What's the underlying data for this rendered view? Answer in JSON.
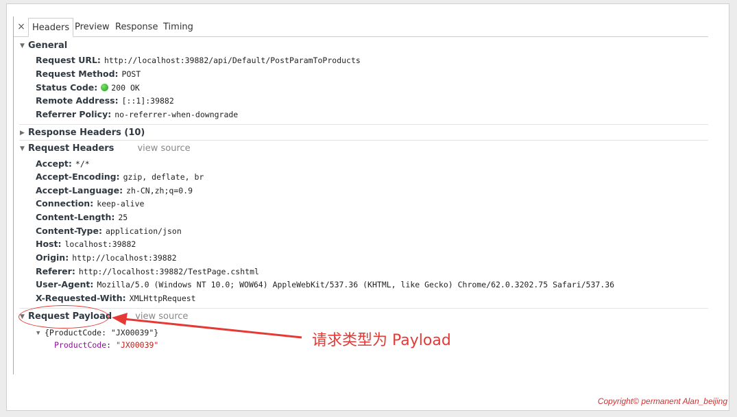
{
  "tabs": {
    "close": "×",
    "headers": "Headers",
    "preview": "Preview",
    "response": "Response",
    "timing": "Timing"
  },
  "general": {
    "title": "General",
    "rows": [
      {
        "key": "Request URL:",
        "value": "http://localhost:39882/api/Default/PostParamToProducts"
      },
      {
        "key": "Request Method:",
        "value": "POST"
      },
      {
        "key": "Status Code:",
        "value": "200 OK"
      },
      {
        "key": "Remote Address:",
        "value": "[::1]:39882"
      },
      {
        "key": "Referrer Policy:",
        "value": "no-referrer-when-downgrade"
      }
    ]
  },
  "response_headers": {
    "title": "Response Headers (10)"
  },
  "request_headers": {
    "title": "Request Headers",
    "view_source": "view source",
    "rows": [
      {
        "key": "Accept:",
        "value": "*/*"
      },
      {
        "key": "Accept-Encoding:",
        "value": "gzip, deflate, br"
      },
      {
        "key": "Accept-Language:",
        "value": "zh-CN,zh;q=0.9"
      },
      {
        "key": "Connection:",
        "value": "keep-alive"
      },
      {
        "key": "Content-Length:",
        "value": "25"
      },
      {
        "key": "Content-Type:",
        "value": "application/json"
      },
      {
        "key": "Host:",
        "value": "localhost:39882"
      },
      {
        "key": "Origin:",
        "value": "http://localhost:39882"
      },
      {
        "key": "Referer:",
        "value": "http://localhost:39882/TestPage.cshtml"
      },
      {
        "key": "User-Agent:",
        "value": "Mozilla/5.0 (Windows NT 10.0; WOW64) AppleWebKit/537.36 (KHTML, like Gecko) Chrome/62.0.3202.75 Safari/537.36"
      },
      {
        "key": "X-Requested-With:",
        "value": "XMLHttpRequest"
      }
    ]
  },
  "request_payload": {
    "title": "Request Payload",
    "view_source": "view source",
    "object_summary": "{ProductCode: \"JX00039\"}",
    "prop_key": "ProductCode",
    "prop_value": "\"JX00039\""
  },
  "annotation": {
    "text": "请求类型为  Payload",
    "color": "#e53935"
  },
  "copyright": "Copyright© permanent  Alan_beijing",
  "colors": {
    "status_ok": "#1f9e16",
    "prop_key": "#881391",
    "prop_value": "#c41a16"
  }
}
